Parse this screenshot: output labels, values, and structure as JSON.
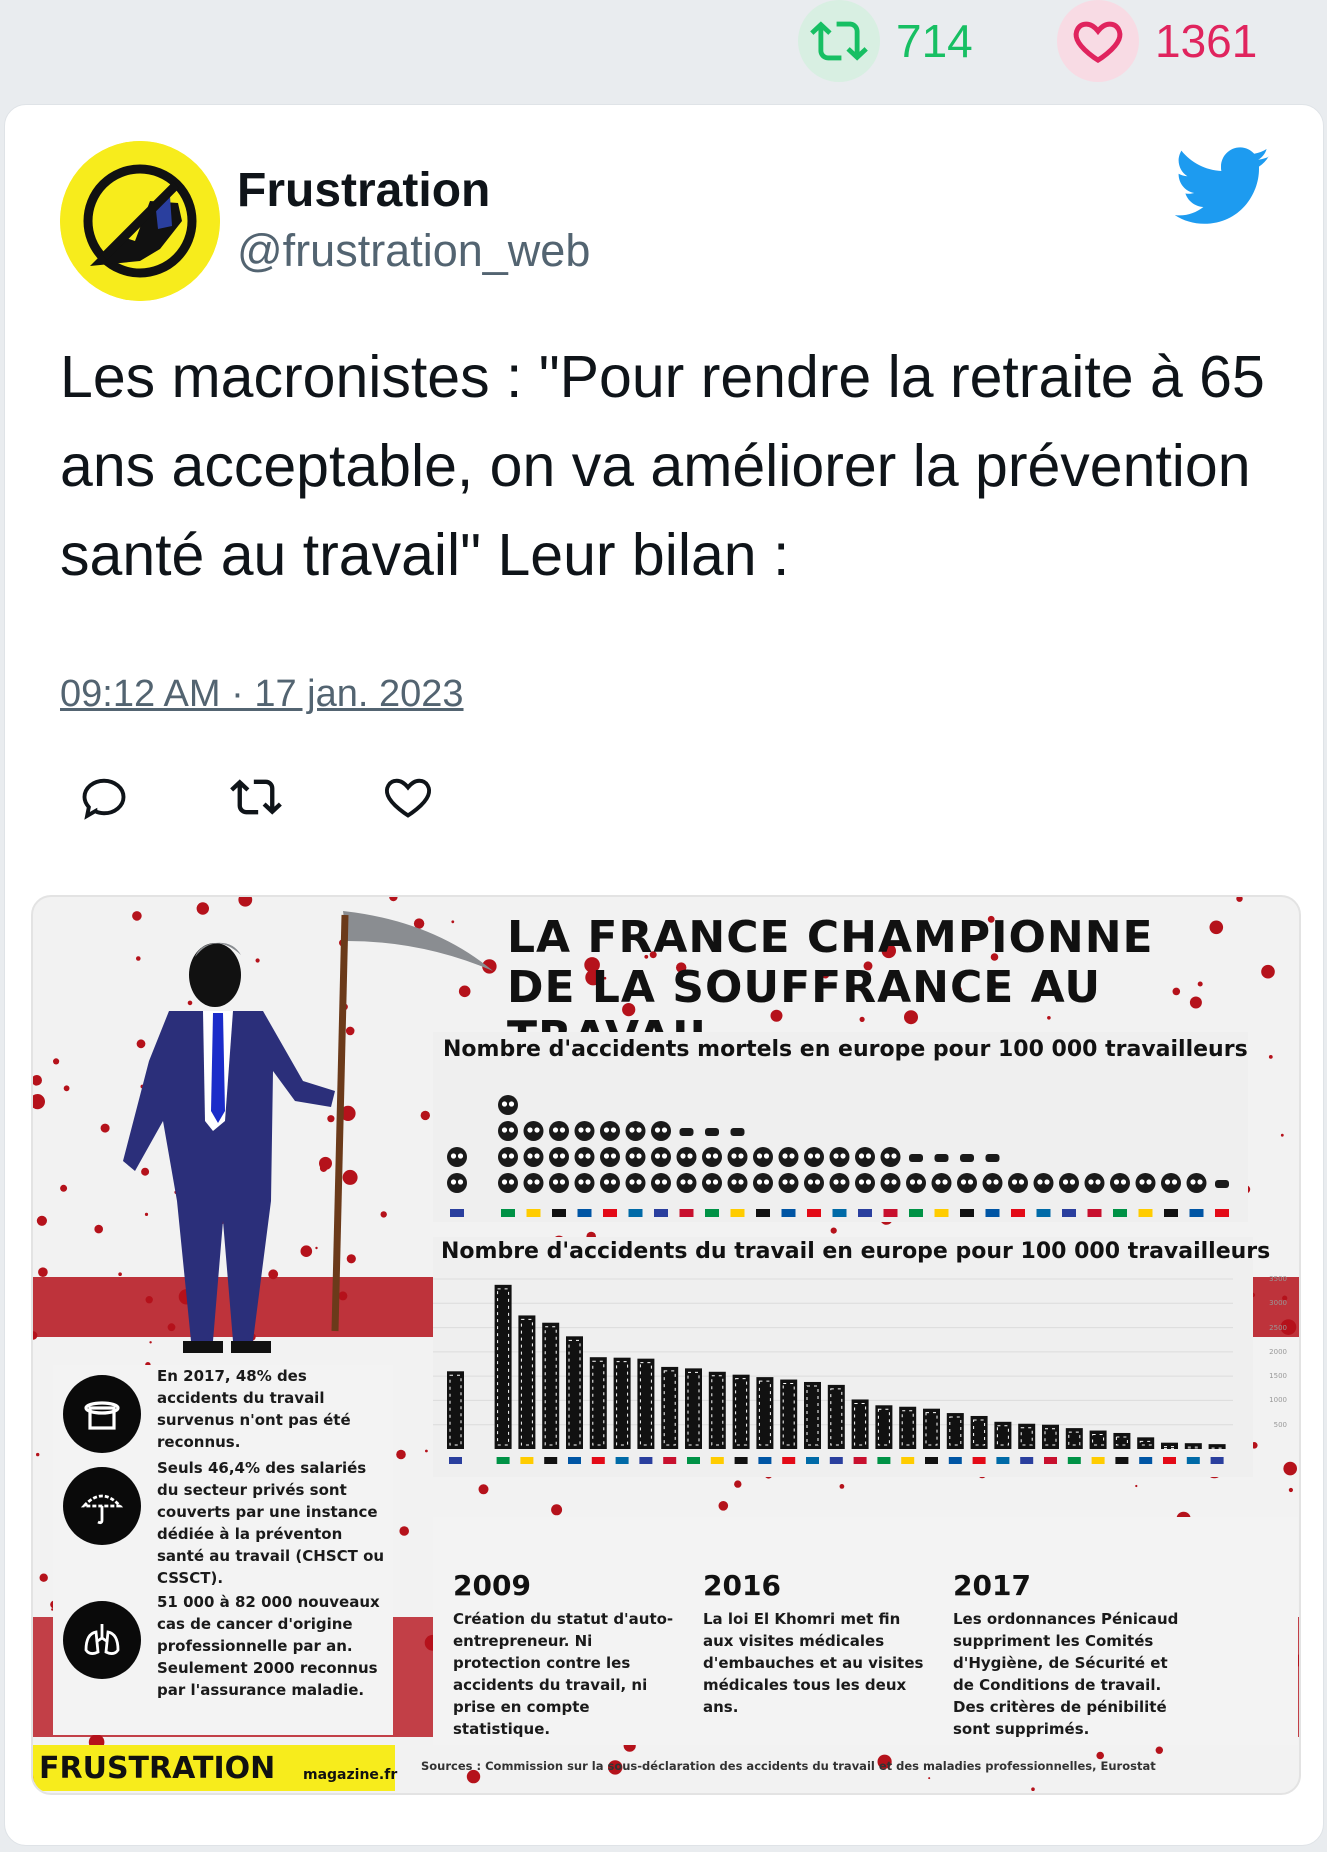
{
  "stats": {
    "retweets": "714",
    "likes": "1361"
  },
  "author": {
    "name": "Frustration",
    "handle": "@frustration_web"
  },
  "tweet": {
    "text": "Les macronistes : \"Pour rendre la retraite à 65 ans acceptable, on va améliorer la prévention santé au travail\" Leur bilan :",
    "timestamp": "09:12 AM · 17 jan. 2023"
  },
  "icons": {
    "retweet": "retweet-icon",
    "like": "heart-icon",
    "reply": "reply-icon",
    "brand": "twitter-bird-icon"
  },
  "colors": {
    "retweet": "#17bf63",
    "like": "#e0245e",
    "twitter": "#1d9bf0",
    "blood": "#b5121b",
    "brand_yellow": "#f7ec1c"
  },
  "infographic": {
    "title_line1": "LA FRANCE CHAMPIONNE",
    "title_line2": "DE LA SOUFFRANCE AU TRAVAIL",
    "facts": [
      "En 2017, 48% des accidents du travail survenus n'ont pas été reconnus.",
      "Seuls 46,4% des salariés du secteur privés sont couverts par une instance dédiée à la préventon santé au travail (CHSCT ou CSSCT).",
      "51 000 à 82 000 nouveaux cas de cancer d'origine professionnelle par an. Seulement 2000 reconnus par l'assurance maladie."
    ],
    "timeline": [
      {
        "year": "2009",
        "text": "Création du statut d'auto-entrepreneur. Ni protection contre les accidents du travail, ni prise en compte statistique."
      },
      {
        "year": "2016",
        "text": "La loi El Khomri met fin aux visites médicales d'embauches et au visites médicales tous les deux ans."
      },
      {
        "year": "2017",
        "text": "Les ordonnances Pénicaud suppriment les Comités d'Hygiène, de Sécurité et de Conditions de travail. Des critères de pénibilité sont supprimés."
      }
    ],
    "brand_main": "FRUSTRATION",
    "brand_sub": "magazine.fr",
    "sources": "Sources : Commission sur la sous-déclaration des accidents du travail et des maladies professionnelles, Eurostat"
  },
  "chart_data": [
    {
      "type": "bar",
      "title": "Nombre d'accidents mortels en europe pour 100 000 travailleurs",
      "values": [
        2,
        0,
        4,
        3,
        3,
        3,
        3,
        3,
        3,
        2.5,
        2.5,
        2.5,
        2,
        2,
        2,
        2,
        2,
        2,
        1.5,
        1.5,
        1.5,
        1.5,
        1,
        1,
        1,
        1,
        1,
        1,
        1,
        1,
        0.5
      ]
    },
    {
      "type": "bar",
      "title": "Nombre d'accidents du travail en europe pour 100 000 travailleurs",
      "yticks": [
        "3500",
        "3000",
        "2500",
        "2000",
        "1500",
        "1000",
        "500"
      ],
      "ylim": [
        0,
        3500
      ],
      "values": [
        1600,
        0,
        3380,
        2750,
        2600,
        2320,
        1890,
        1880,
        1860,
        1690,
        1660,
        1590,
        1530,
        1480,
        1430,
        1380,
        1320,
        1020,
        900,
        870,
        830,
        740,
        680,
        560,
        520,
        500,
        430,
        380,
        330,
        240,
        130,
        120,
        100
      ]
    }
  ]
}
